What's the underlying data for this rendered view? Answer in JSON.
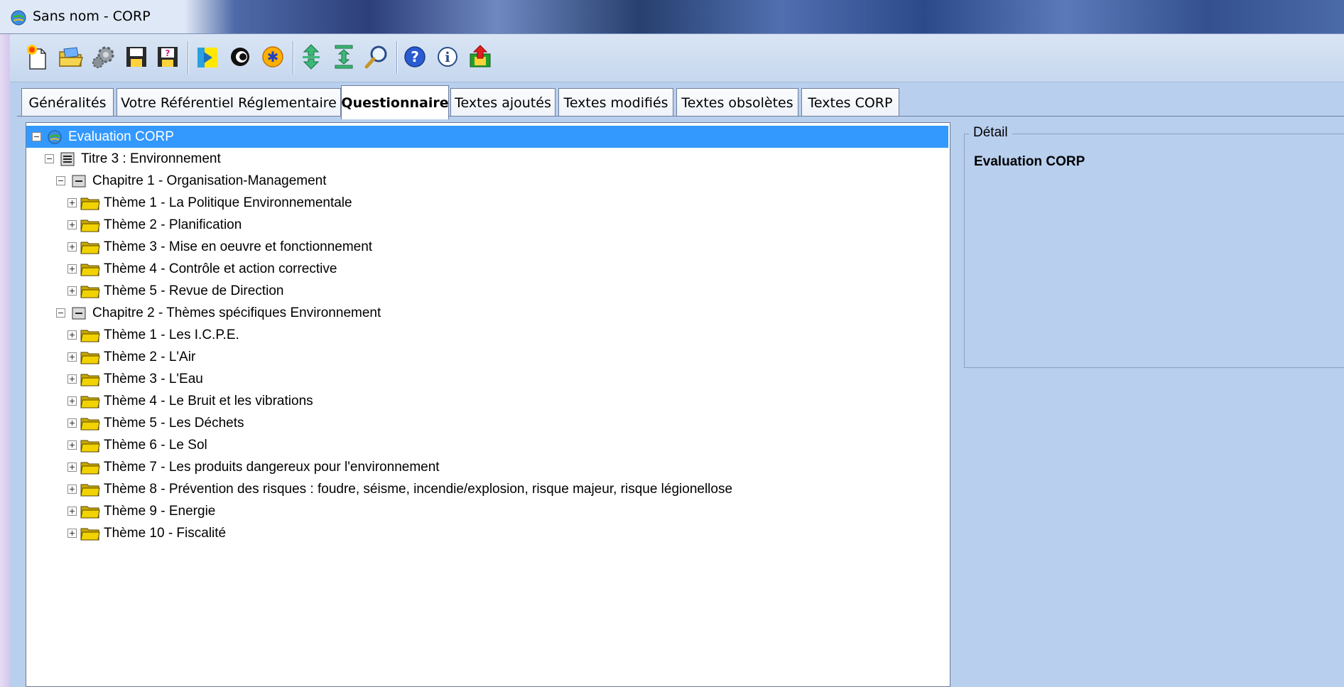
{
  "window": {
    "title": "Sans nom - CORP"
  },
  "toolbar": {
    "buttons": [
      {
        "icon": "new-document-icon"
      },
      {
        "icon": "open-folder-icon"
      },
      {
        "icon": "settings-gear-icon"
      },
      {
        "icon": "save-icon"
      },
      {
        "icon": "save-as-help-icon"
      },
      {
        "icon": "import-icon"
      },
      {
        "icon": "circle-icon"
      },
      {
        "icon": "star-icon"
      },
      {
        "icon": "expand-vertical-icon"
      },
      {
        "icon": "collapse-vertical-icon"
      },
      {
        "icon": "search-icon"
      },
      {
        "icon": "help-icon"
      },
      {
        "icon": "info-icon"
      },
      {
        "icon": "export-icon"
      }
    ]
  },
  "tabs": [
    {
      "label": "Généralités",
      "active": false
    },
    {
      "label": "Votre Référentiel Réglementaire",
      "active": false
    },
    {
      "label": "Questionnaire",
      "active": true
    },
    {
      "label": "Textes ajoutés",
      "active": false
    },
    {
      "label": "Textes modifiés",
      "active": false
    },
    {
      "label": "Textes obsolètes",
      "active": false
    },
    {
      "label": "Textes CORP",
      "active": false
    }
  ],
  "tree": {
    "root": "Evaluation CORP",
    "title": "Titre 3 : Environnement",
    "chapters": [
      {
        "label": "Chapitre 1 - Organisation-Management",
        "themes": [
          "Thème 1 - La Politique Environnementale",
          "Thème 2 - Planification",
          "Thème 3 - Mise en oeuvre et fonctionnement",
          "Thème 4 - Contrôle et action corrective",
          "Thème 5 - Revue de Direction"
        ]
      },
      {
        "label": "Chapitre 2 - Thèmes spécifiques Environnement",
        "themes": [
          "Thème 1 - Les I.C.P.E.",
          "Thème 2 - L'Air",
          "Thème 3 - L'Eau",
          "Thème 4 - Le Bruit et les vibrations",
          "Thème 5 - Les Déchets",
          "Thème 6 - Le Sol",
          "Thème 7 - Les produits dangereux pour l'environnement",
          "Thème 8 - Prévention des risques : foudre, séisme, incendie/explosion, risque majeur, risque légionellose",
          "Thème 9 - Energie",
          "Thème 10 - Fiscalité"
        ]
      }
    ]
  },
  "detail": {
    "legend": "Détail",
    "value": "Evaluation CORP"
  },
  "colors": {
    "selection": "#3399ff",
    "panel_background": "#b9cfee",
    "folder": "#f2d200"
  }
}
